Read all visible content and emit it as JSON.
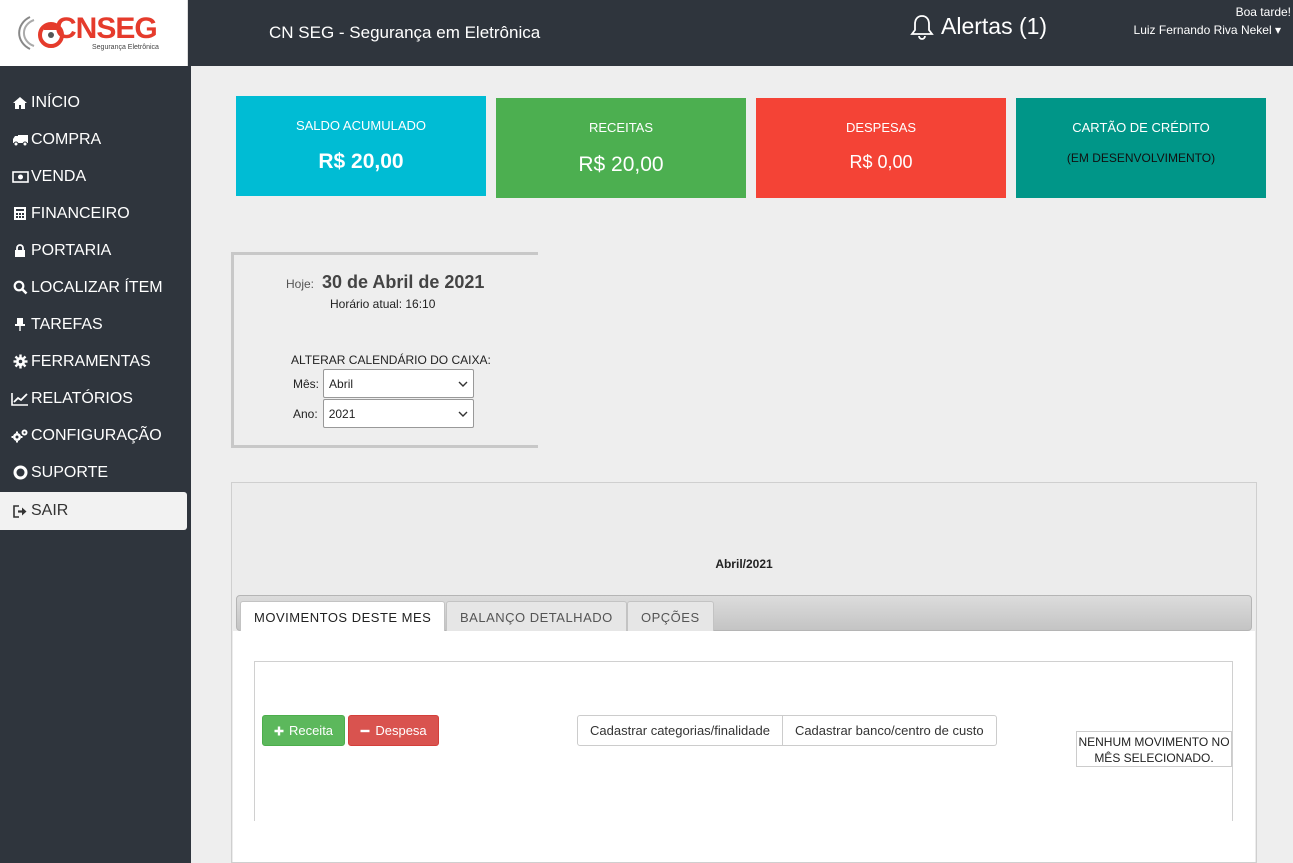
{
  "header": {
    "logo_text": "CNSEG",
    "logo_tagline": "Segurança Eletrônica",
    "app_title": "CN SEG - Segurança em Eletrônica",
    "alerts_label": "Alertas (1)",
    "greeting": "Boa tarde!",
    "user_name": "Luiz Fernando Riva Nekel",
    "user_menu_caret": "▾",
    "colors": {
      "bar": "#2f353d"
    }
  },
  "sidebar": {
    "items": [
      {
        "label": "INÍCIO",
        "icon": "home-icon"
      },
      {
        "label": "COMPRA",
        "icon": "truck-icon"
      },
      {
        "label": "VENDA",
        "icon": "money-icon"
      },
      {
        "label": "FINANCEIRO",
        "icon": "calculator-icon"
      },
      {
        "label": "PORTARIA",
        "icon": "lock-icon"
      },
      {
        "label": "LOCALIZAR ÍTEM",
        "icon": "search-icon"
      },
      {
        "label": "TAREFAS",
        "icon": "pin-icon"
      },
      {
        "label": "FERRAMENTAS",
        "icon": "gear-icon"
      },
      {
        "label": "RELATÓRIOS",
        "icon": "line-chart-icon"
      },
      {
        "label": "CONFIGURAÇÃO",
        "icon": "gears-icon"
      },
      {
        "label": "SUPORTE",
        "icon": "lifebuoy-icon"
      },
      {
        "label": "SAIR",
        "icon": "sign-out-icon"
      }
    ]
  },
  "cards": {
    "saldo": {
      "label": "SALDO ACUMULADO",
      "value": "R$ 20,00",
      "color": "#00bcd4"
    },
    "receitas": {
      "label": "RECEITAS",
      "value": "R$ 20,00",
      "color": "#4caf50"
    },
    "despesas": {
      "label": "DESPESAS",
      "value": "R$ 0,00",
      "color": "#f44336"
    },
    "cartao": {
      "label": "CARTÃO DE CRÉDITO",
      "value": "(EM DESENVOLVIMENTO)",
      "color": "#009688"
    }
  },
  "date_panel": {
    "today_label": "Hoje:",
    "today_value": "30 de Abril de 2021",
    "time_text": "Horário atual: 16:10",
    "calendar_title": "ALTERAR CALENDÁRIO DO CAIXA:",
    "month_label": "Mês:",
    "month_value": "Abril",
    "year_label": "Ano:",
    "year_value": "2021"
  },
  "main": {
    "period": "Abril/2021",
    "tabs": [
      {
        "label": "MOVIMENTOS DESTE MES"
      },
      {
        "label": "BALANÇO DETALHADO"
      },
      {
        "label": "OPÇÕES"
      }
    ],
    "receita_button": "Receita",
    "despesa_button": "Despesa",
    "categorias_button": "Cadastrar categorias/finalidade",
    "banco_button": "Cadastrar banco/centro de custo",
    "empty_message": "NENHUM MOVIMENTO NO MÊS SELECIONADO."
  }
}
